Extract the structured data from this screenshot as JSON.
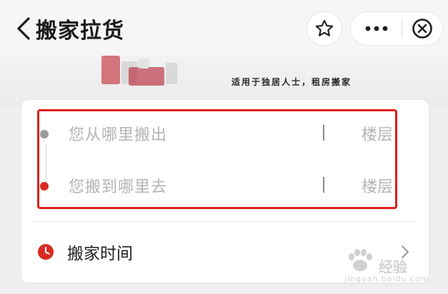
{
  "header": {
    "title": "搬家拉货",
    "back_icon": "chevron-left-icon",
    "star_icon": "star-icon",
    "more_icon": "more-horizontal-icon",
    "close_icon": "close-circle-icon"
  },
  "banner": {
    "tagline": "适用于独居人士，租房搬家"
  },
  "form": {
    "from_placeholder": "您从哪里搬出",
    "to_placeholder": "您搬到哪里去",
    "floor_label": "楼层",
    "separator": "|",
    "time_label": "搬家时间"
  },
  "watermark": {
    "text": "经验",
    "sub": "jingyan.baidu.com"
  },
  "colors": {
    "accent_red": "#d72b22",
    "highlight_red": "#e0201e",
    "placeholder_grey": "#b4b4b4"
  }
}
